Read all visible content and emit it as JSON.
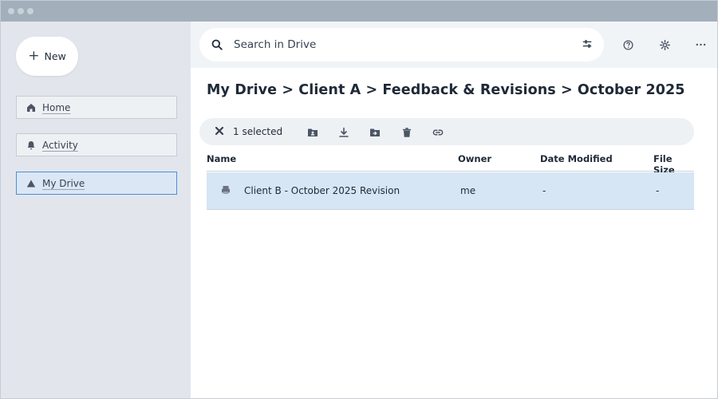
{
  "window": {
    "titlebar_dots": 3
  },
  "sidebar": {
    "new_button": "New",
    "items": [
      {
        "label": "Home",
        "icon": "home-icon",
        "active": false
      },
      {
        "label": "Activity",
        "icon": "bell-icon",
        "active": false
      },
      {
        "label": "My Drive",
        "icon": "drive-icon",
        "active": true
      }
    ]
  },
  "search": {
    "placeholder": "Search in Drive"
  },
  "breadcrumb": "My Drive > Client A > Feedback & Revisions > October 2025",
  "selection": {
    "text": "1 selected"
  },
  "table": {
    "headers": [
      "Name",
      "Owner",
      "Date Modified",
      "File Size"
    ],
    "rows": [
      {
        "name": "Client B - October 2025 Revision",
        "owner": "me",
        "modified": "-",
        "size": "-",
        "icon": "file-icon",
        "selected": true
      }
    ]
  },
  "colors": {
    "selected_row": "#d6e6f5",
    "active_nav_border": "#4a90d9",
    "sidebar_bg": "#e2e6ec"
  }
}
